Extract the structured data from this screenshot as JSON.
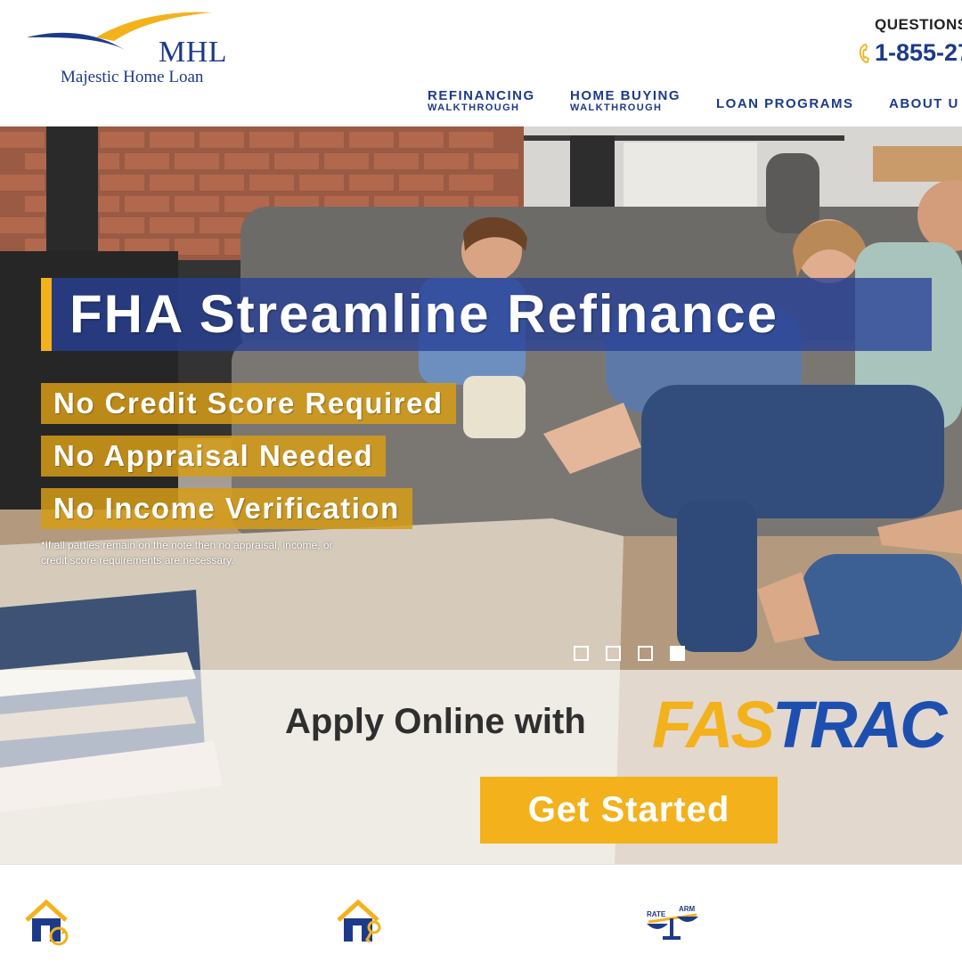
{
  "brand": {
    "logo_abbr": "MHL",
    "logo_name": "Majestic Home Loan",
    "logo_icon": "swoosh-logo-icon"
  },
  "contact": {
    "questions_label": "QUESTIONS",
    "phone": "1-855-27",
    "phone_icon": "phone-icon"
  },
  "nav": {
    "refinancing_line1": "REFINANCING",
    "refinancing_line2": "WALKTHROUGH",
    "home_buying_line1": "HOME BUYING",
    "home_buying_line2": "WALKTHROUGH",
    "loan_programs": "LOAN PROGRAMS",
    "about": "ABOUT U"
  },
  "hero": {
    "headline": "FHA Streamline Refinance",
    "benefits": [
      "No Credit Score Required",
      "No Appraisal Needed",
      "No Income Verification"
    ],
    "disclaimer": "*If all parties remain on the note then no appraisal, income, or credit score requirements are necessary.",
    "slides_total": 4,
    "slide_active": 4
  },
  "cta": {
    "apply_text": "Apply Online with",
    "fastrac_part1": "FAS",
    "fastrac_part2": "TRAC",
    "button_label": "Get Started"
  },
  "features": {
    "icons": [
      "house-refresh-icon",
      "house-key-icon",
      "rate-arm-scale-icon"
    ],
    "scale_labels": [
      "RATE",
      "ARM"
    ]
  },
  "colors": {
    "navy": "#1d3a8a",
    "gold": "#f3b11c",
    "blue_accent": "#1d4fb0"
  }
}
